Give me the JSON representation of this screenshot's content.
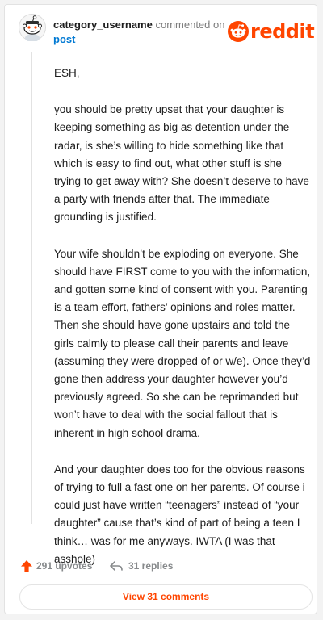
{
  "comment": {
    "username": "category_username",
    "action_text": "commented on",
    "post_link": "post",
    "paragraphs": [
      "ESH,",
      "you should be pretty upset that your daughter is keeping something as big as detention under the radar, is she’s willing to hide something like that which is easy to find out, what other stuff is she trying to get away with? She doesn’t deserve to have a party with friends after that. The immediate grounding is justified.",
      "Your wife shouldn’t be exploding on everyone. She should have FIRST come to you with the information, and gotten some kind of consent with you. Parenting is a team effort, fathers’ opinions and roles matter. Then she should have gone upstairs and told the girls calmly to please call their parents and leave (assuming they were dropped of or w/e). Once they’d gone then address your daughter however you’d previously agreed. So she can be reprimanded but won’t have to deal with the social fallout that is inherent in high school drama.",
      "And your daughter does too for the obvious reasons of trying to full a fast one on her parents. Of course i could just have written “teenagers” instead of “your daughter” cause that’s kind of part of being a teen I think… was for me anyways. IWTA (I was that asshole)"
    ]
  },
  "brand": {
    "wordmark": "reddit",
    "color": "#ff4500"
  },
  "footer": {
    "upvotes": "291 upvotes",
    "replies": "31 replies",
    "view_comments": "View 31 comments"
  },
  "icons": {
    "avatar": "snoo-avatar-icon",
    "logo": "reddit-snoo-icon",
    "upvote": "upvote-arrow-icon",
    "reply": "reply-arrow-icon"
  }
}
